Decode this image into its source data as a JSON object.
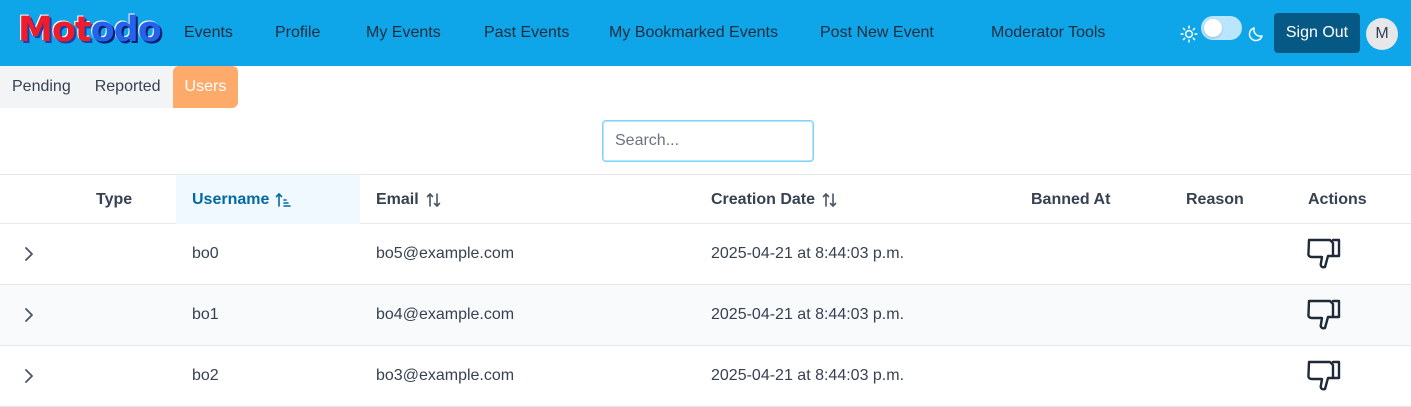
{
  "app": {
    "logo_part1": "Mot",
    "logo_part2": "odo"
  },
  "nav": {
    "events": "Events",
    "profile": "Profile",
    "my_events": "My Events",
    "past_events": "Past Events",
    "bookmarked": "My Bookmarked Events",
    "post_new": "Post New Event",
    "moderator": "Moderator Tools"
  },
  "header": {
    "sign_out": "Sign Out",
    "avatar_initial": "M",
    "dark_mode_enabled": false
  },
  "tabs": {
    "pending": "Pending",
    "reported": "Reported",
    "users": "Users",
    "active": "Users"
  },
  "search": {
    "placeholder": "Search...",
    "value": ""
  },
  "table": {
    "columns": {
      "type": "Type",
      "username": "Username",
      "email": "Email",
      "creation_date": "Creation Date",
      "banned_at": "Banned At",
      "reason": "Reason",
      "actions": "Actions"
    },
    "sorted_column": "Username",
    "rows": [
      {
        "type": "",
        "username": "bo0",
        "email": "bo5@example.com",
        "creation_date": "2025-04-21 at 8:44:03 p.m.",
        "banned_at": "",
        "reason": ""
      },
      {
        "type": "",
        "username": "bo1",
        "email": "bo4@example.com",
        "creation_date": "2025-04-21 at 8:44:03 p.m.",
        "banned_at": "",
        "reason": ""
      },
      {
        "type": "",
        "username": "bo2",
        "email": "bo3@example.com",
        "creation_date": "2025-04-21 at 8:44:03 p.m.",
        "banned_at": "",
        "reason": ""
      }
    ]
  },
  "colors": {
    "navbar": "#0ea5e9",
    "sign_out_bg": "#075985",
    "active_tab": "#fdaa6b",
    "sorted_header": "#0369a1"
  },
  "icons": {
    "theme_light": "sun-icon",
    "theme_dark": "moon-icon",
    "row_expand": "chevron-right-icon",
    "action": "thumbs-down-icon",
    "sort": "sort-arrows-icon"
  }
}
